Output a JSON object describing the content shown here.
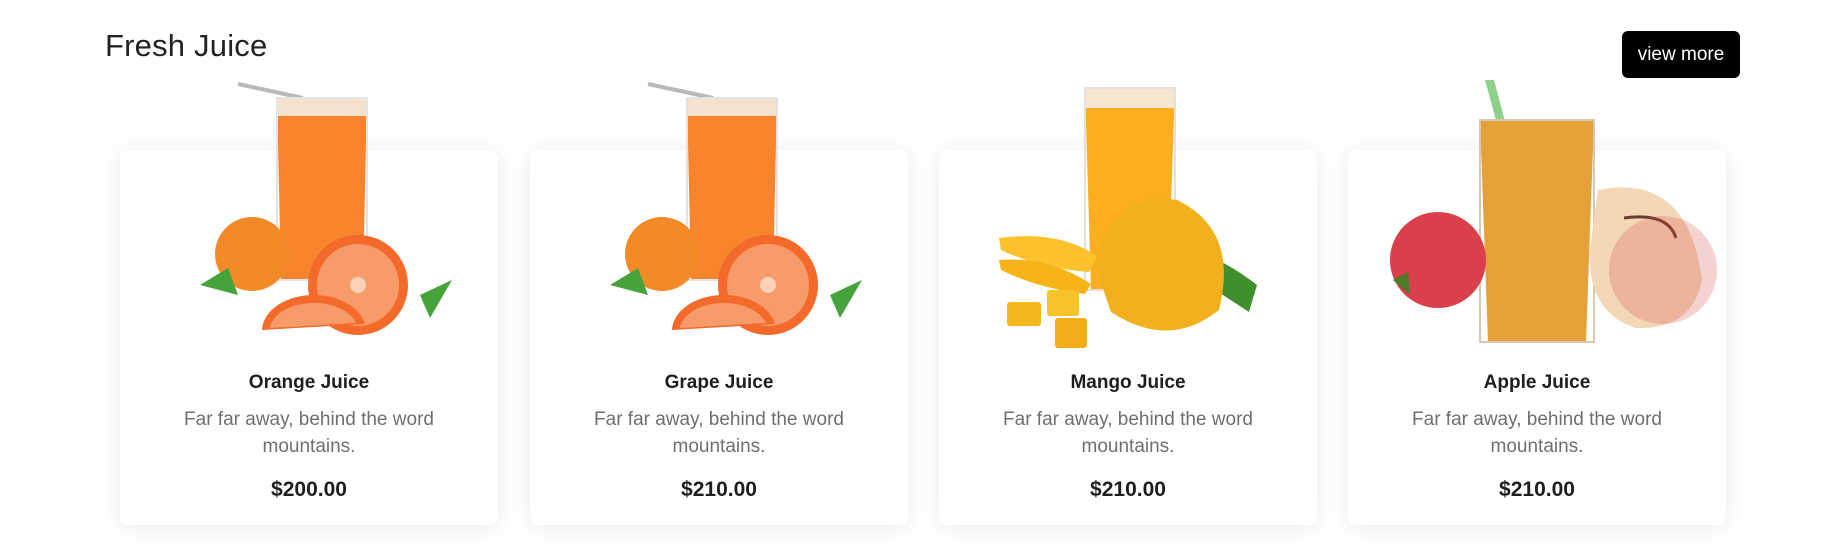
{
  "section": {
    "title": "Fresh Juice",
    "view_more_label": "view more"
  },
  "products": [
    {
      "name": "Orange Juice",
      "description": "Far far away, behind the word mountains.",
      "price": "$200.00",
      "image_icon": "orange-juice-icon"
    },
    {
      "name": "Grape Juice",
      "description": "Far far away, behind the word mountains.",
      "price": "$210.00",
      "image_icon": "orange-juice-icon"
    },
    {
      "name": "Mango Juice",
      "description": "Far far away, behind the word mountains.",
      "price": "$210.00",
      "image_icon": "mango-juice-icon"
    },
    {
      "name": "Apple Juice",
      "description": "Far far away, behind the word mountains.",
      "price": "$210.00",
      "image_icon": "apple-juice-icon"
    }
  ],
  "colors": {
    "button_bg": "#000000",
    "button_text": "#ffffff",
    "title_text": "#222222",
    "description_text": "#6f6f6f",
    "price_text": "#1e1e1e"
  }
}
